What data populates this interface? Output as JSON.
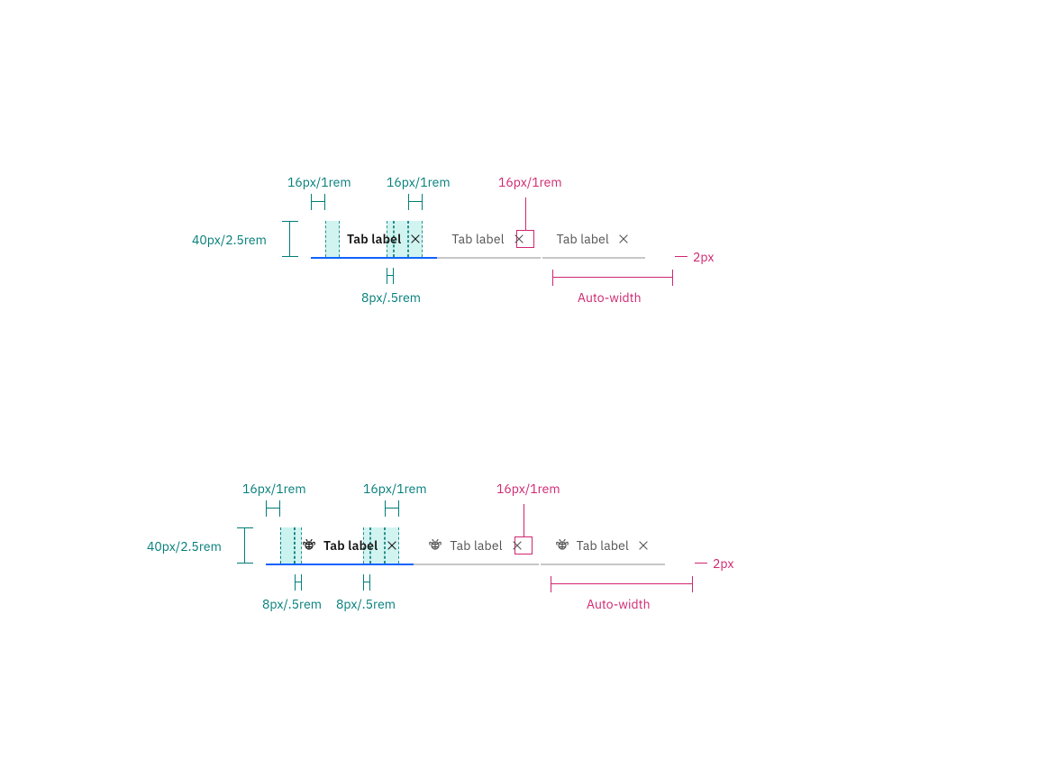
{
  "colors": {
    "teal": "#007d79",
    "teal_fill": "#c9f3ef",
    "magenta": "#d02670",
    "blue": "#0f62fe",
    "gray_border": "#c6c6c6"
  },
  "specs": {
    "height": "40px/2.5rem",
    "pad_lr": "16px/1rem",
    "gap": "8px/.5rem",
    "close_icon": "16px/1rem",
    "underline": "2px",
    "auto_width": "Auto-width"
  },
  "tabs": {
    "active_label": "Tab label",
    "inactive_label": "Tab label",
    "third_label": "Tab label"
  }
}
